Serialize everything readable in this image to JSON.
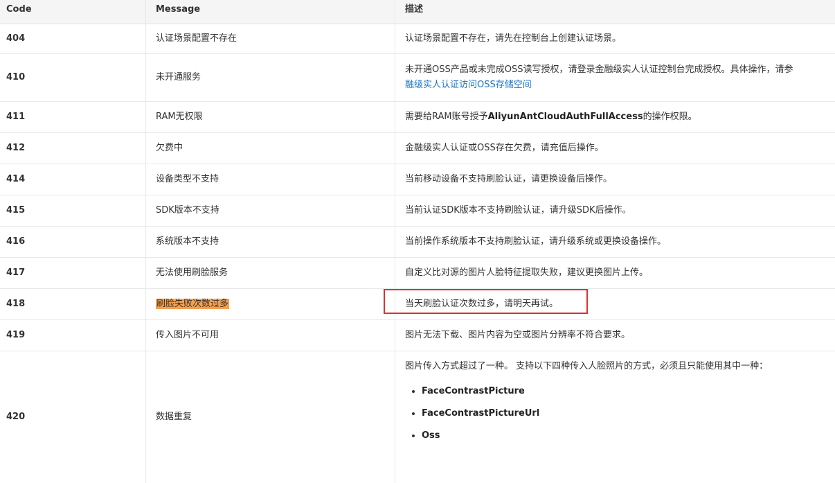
{
  "header": {
    "code": "Code",
    "message": "Message",
    "description": "描述"
  },
  "rows": [
    {
      "code": "404",
      "message": "认证场景配置不存在",
      "desc": "认证场景配置不存在，请先在控制台上创建认证场景。"
    },
    {
      "code": "410",
      "message": "未开通服务",
      "desc": "未开通OSS产品或未完成OSS读写授权，请登录金融级实人认证控制台完成授权。具体操作，请参",
      "desc_link": "融级实人认证访问OSS存储空间"
    },
    {
      "code": "411",
      "message": "RAM无权限",
      "desc_pre": "需要给RAM账号授予",
      "desc_strong": "AliyunAntCloudAuthFullAccess",
      "desc_post": "的操作权限。"
    },
    {
      "code": "412",
      "message": "欠费中",
      "desc": "金融级实人认证或OSS存在欠费，请充值后操作。"
    },
    {
      "code": "414",
      "message": "设备类型不支持",
      "desc": "当前移动设备不支持刷脸认证，请更换设备后操作。"
    },
    {
      "code": "415",
      "message": "SDK版本不支持",
      "desc": "当前认证SDK版本不支持刷脸认证，请升级SDK后操作。"
    },
    {
      "code": "416",
      "message": "系统版本不支持",
      "desc": "当前操作系统版本不支持刷脸认证，请升级系统或更换设备操作。"
    },
    {
      "code": "417",
      "message": "无法使用刷脸服务",
      "desc": "自定义比对源的图片人脸特征提取失败，建议更换图片上传。"
    },
    {
      "code": "418",
      "message": "刷脸失败次数过多",
      "desc": "当天刷脸认证次数过多，请明天再试。"
    },
    {
      "code": "419",
      "message": "传入图片不可用",
      "desc": "图片无法下载、图片内容为空或图片分辨率不符合要求。"
    },
    {
      "code": "420",
      "message": "数据重复",
      "desc": "图片传入方式超过了一种。 支持以下四种传入人脸照片的方式，必须且只能使用其中一种：",
      "bullets": [
        "FaceContrastPicture",
        "FaceContrastPictureUrl",
        "Oss"
      ]
    }
  ]
}
